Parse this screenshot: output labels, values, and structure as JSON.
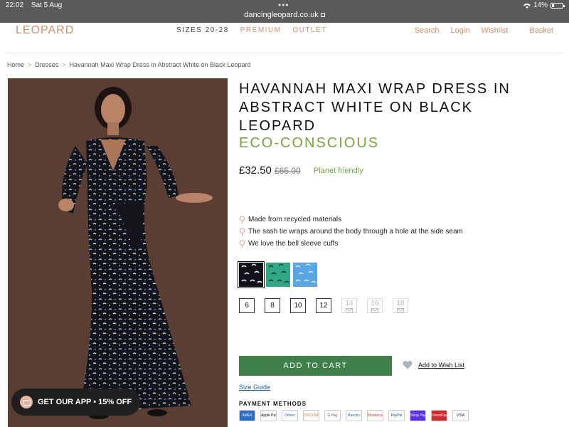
{
  "status_bar": {
    "time": "22:02",
    "date": "Sat 5 Aug",
    "url": "dancingleopard.co.uk",
    "battery": "14%"
  },
  "header": {
    "logo": "LEOPARD",
    "nav": {
      "sizes": "SIZES 20-28",
      "premium": "PREMIUM",
      "outlet": "OUTLET"
    },
    "user_nav": {
      "search": "Search",
      "login": "Login",
      "wishlist": "Wishlist",
      "basket": "Basket"
    }
  },
  "breadcrumb": {
    "items": [
      "Home",
      "Dresses",
      "Havannah Maxi Wrap Dress in Abstract White on Black Leopard"
    ]
  },
  "product": {
    "title": "HAVANNAH MAXI WRAP DRESS IN ABSTRACT WHITE ON BLACK LEOPARD",
    "eco_tag": "ECO-CONSCIOUS",
    "price": "£32.50",
    "old_price": "£65.00",
    "badge": "Planet friendly",
    "features": [
      "Made from recycled materials",
      "The sash tie wraps around the body through a hole at the side seam",
      "We love the bell sleeve cuffs"
    ],
    "sizes": [
      "6",
      "8",
      "10",
      "12",
      "14",
      "16",
      "18"
    ],
    "add_to_cart": "ADD TO CART",
    "add_to_wishlist": "Add to Wish List",
    "size_guide": "Size Guide",
    "payment_methods_label": "PAYMENT METHODS",
    "payment_methods": [
      "AMEX",
      "Apple Pay",
      "Diners",
      "DISCOVER",
      "G Pay",
      "Maestro",
      "Mastercard",
      "PayPal",
      "Shop Pay",
      "UnionPay",
      "VISA"
    ]
  },
  "app_banner": {
    "text": "GET OUR APP • 15% OFF"
  },
  "colors": {
    "brand": "#d98e6c",
    "eco_green": "#7aa33b",
    "cart_green": "#3f7f4a",
    "banner_bg": "#1f1f1f",
    "image_bg": "#5b3e33"
  }
}
